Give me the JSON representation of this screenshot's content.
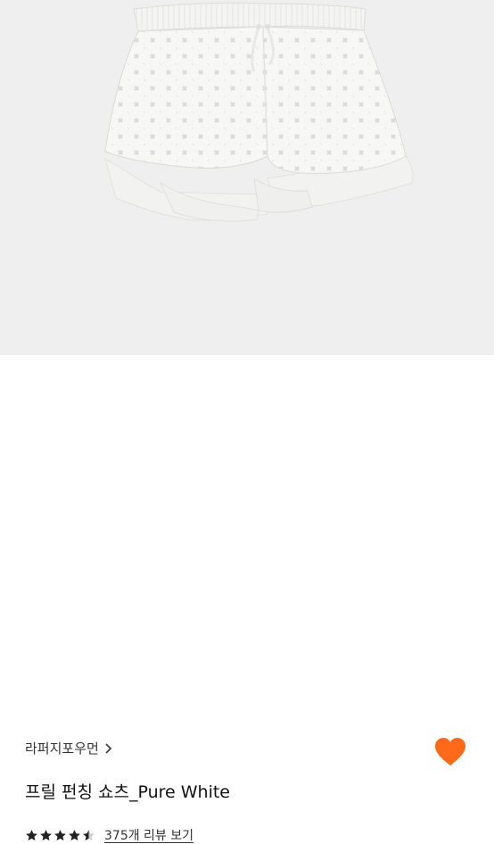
{
  "product": {
    "image_alt": "white ruffle punching shorts",
    "brand_label": "라퍼지포우먼",
    "brand_chevron_icon": "chevron-right-icon",
    "title": "프릴 펀칭 쇼츠_Pure White",
    "favorite": {
      "icon": "heart-icon",
      "active": true,
      "color": "#ff6a1a"
    },
    "rating": {
      "value": 4.5,
      "max": 5,
      "icon": "star-icon",
      "color": "#222222"
    },
    "review_link_label": "375개 리뷰 보기"
  },
  "colors": {
    "image_background": "#efeff0",
    "accent": "#ff6a1a"
  }
}
